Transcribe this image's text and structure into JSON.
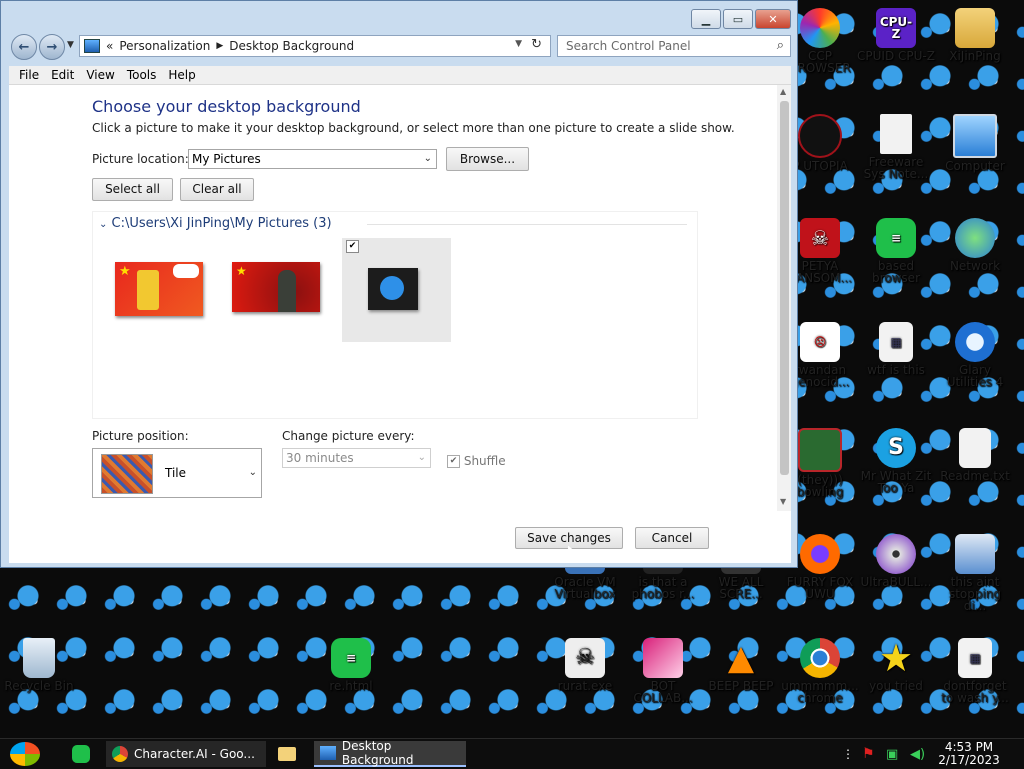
{
  "window": {
    "breadcrumb": {
      "chevrons": "«",
      "root": "Personalization",
      "current": "Desktop Background"
    },
    "search_placeholder": "Search Control Panel",
    "menu": [
      "File",
      "Edit",
      "View",
      "Tools",
      "Help"
    ],
    "heading": "Choose your desktop background",
    "subtitle": "Click a picture to make it your desktop background, or select more than one picture to create a slide show.",
    "picture_location": {
      "label": "Picture location:",
      "value": "My Pictures",
      "browse": "Browse..."
    },
    "select_all": "Select all",
    "clear_all": "Clear all",
    "group_path": "C:\\Users\\Xi JinPing\\My Pictures (3)",
    "picture_position": {
      "label": "Picture position:",
      "value": "Tile"
    },
    "change_picture": {
      "label": "Change picture every:",
      "value": "30 minutes"
    },
    "shuffle": "Shuffle",
    "save": "Save changes",
    "cancel": "Cancel"
  },
  "desktop_icons": [
    {
      "label": "CCP BROWSER",
      "color": "#ff7a1a"
    },
    {
      "label": "CPUID CPU-Z",
      "color": "#6a2bd6"
    },
    {
      "label": "XiJinPing",
      "color": "#e0b040"
    },
    {
      "label": "P UTOPIA",
      "color": "#a0121a"
    },
    {
      "label": "Freeware Sys Note...",
      "color": "#dcdcdc"
    },
    {
      "label": "Computer",
      "color": "#3b8ee0"
    },
    {
      "label": "PETYA RANSOM...",
      "color": "#c0121a"
    },
    {
      "label": "based browser",
      "color": "#1fbf4a"
    },
    {
      "label": "Network",
      "color": "#2a7fd6"
    },
    {
      "label": "rwandan genocid...",
      "color": "#ffffff"
    },
    {
      "label": "wtf is this",
      "color": "#dcdcdc"
    },
    {
      "label": "Glary Utilities 4",
      "color": "#1e6fd2"
    },
    {
      "label": "(they))) bowling",
      "color": "#b8262a"
    },
    {
      "label": "Mr What Zit Too Ya",
      "color": "#1ba1e2"
    },
    {
      "label": "Readme.txt",
      "color": "#e8e8e8"
    },
    {
      "label": "Oracle VM Virtualbox",
      "color": "#3a72b8"
    },
    {
      "label": "is that a phobos r...",
      "color": "#222222"
    },
    {
      "label": "WE ALL SCRE...",
      "color": "#333333"
    },
    {
      "label": "FURRY FOX UWU",
      "color": "#ff6a00"
    },
    {
      "label": "UltraBULL...",
      "color": "#9a9a9a"
    },
    {
      "label": "this aint stopping di...",
      "color": "#5a8fd0"
    },
    {
      "label": "Recycle Bin",
      "color": "#9fb8d0"
    },
    {
      "label": "re.html",
      "color": "#1fbf4a"
    },
    {
      "label": "rurat.exe",
      "color": "#eeeeee"
    },
    {
      "label": "BOT COLLAB...",
      "color": "#d8207a"
    },
    {
      "label": "BEEP BEEP",
      "color": "#ff8a00"
    },
    {
      "label": "ummmmm... chrome",
      "color": "#2fa24a"
    },
    {
      "label": "you tried",
      "color": "#f5d31a"
    },
    {
      "label": "dontforget to wash y...",
      "color": "#e8e8e8"
    }
  ],
  "taskbar": {
    "items": [
      "Character.AI - Goo...",
      "Desktop Background"
    ],
    "time": "4:53 PM",
    "date": "2/17/2023"
  }
}
